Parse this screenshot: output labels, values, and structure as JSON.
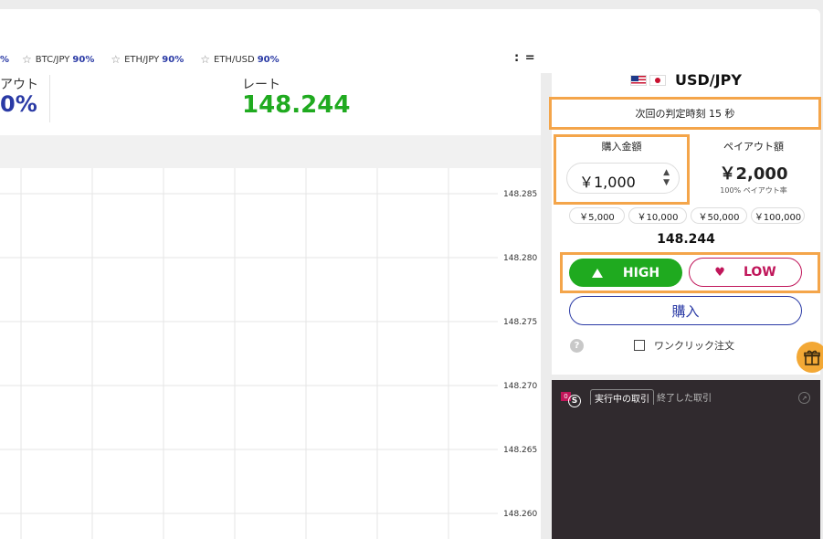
{
  "favorites": [
    {
      "pair": "",
      "pct": "%"
    },
    {
      "pair": "BTC/JPY",
      "pct": "90%"
    },
    {
      "pair": "ETH/JPY",
      "pct": "90%"
    },
    {
      "pair": "ETH/USD",
      "pct": "90%"
    }
  ],
  "menu_glyph": ": =",
  "stats": {
    "payout_label": "アウト",
    "payout_value": "0%",
    "rate_label": "レート",
    "rate_value": "148.244"
  },
  "chart_data": {
    "type": "line",
    "y_ticks": [
      "148.285",
      "148.280",
      "148.275",
      "148.270",
      "148.265",
      "148.260"
    ],
    "ylim": [
      148.258,
      148.287
    ],
    "grid": true,
    "series": []
  },
  "trade": {
    "pair": "USD/JPY",
    "next_judge": "次回の判定時刻 15 秒",
    "amount_label": "購入金額",
    "amount_value": "￥1,000",
    "payout_label": "ペイアウト額",
    "payout_amount": "￥2,000",
    "payout_rate": "100% ペイアウト率",
    "quick_amounts": [
      "￥5,000",
      "￥10,000",
      "￥50,000",
      "￥100,000"
    ],
    "current_rate": "148.244",
    "high_label": "HIGH",
    "low_label": "LOW",
    "buy_label": "購入",
    "help_glyph": "?",
    "oneclick_label": "ワンクリック注文"
  },
  "trades": {
    "badge": "0",
    "logo_letter": "S",
    "tab_active": "実行中の取引",
    "tab_inactive": "終了した取引"
  },
  "colors": {
    "accent_blue": "#2a3aa5",
    "green": "#1faa1f",
    "red": "#c0165a",
    "highlight": "#f4a54a",
    "gift": "#f3a835"
  }
}
